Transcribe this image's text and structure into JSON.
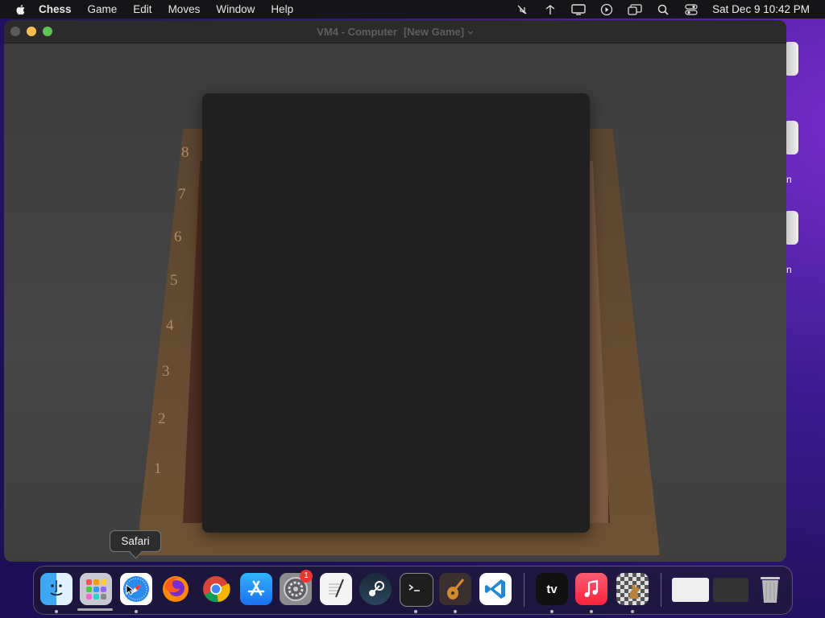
{
  "menubar": {
    "app_name": "Chess",
    "items": [
      "Game",
      "Edit",
      "Moves",
      "Window",
      "Help"
    ],
    "clock": "Sat Dec 9  10:42 PM"
  },
  "window": {
    "title": "VM4 - Computer",
    "subtitle": "[New Game]",
    "ranks": [
      "8",
      "7",
      "6",
      "5",
      "4",
      "3",
      "2",
      "1"
    ]
  },
  "desktop": {
    "label_fragment_1": "n",
    "label_fragment_2": "n"
  },
  "tooltip": {
    "text": "Safari"
  },
  "dock": {
    "apps": [
      "Finder",
      "Launchpad",
      "Safari",
      "Firefox",
      "Google Chrome",
      "App Store",
      "System Settings",
      "TextEdit",
      "Steam",
      "Terminal",
      "GarageBand",
      "Visual Studio Code",
      "TV",
      "Music",
      "Chess",
      "Window Preview 1",
      "Window Preview 2",
      "Trash"
    ],
    "settings_badge": "1",
    "tv_label": "tv"
  },
  "colors": {
    "close": "#5a5a5a",
    "minimize": "#f6bf4f",
    "maximize": "#5fc454"
  }
}
